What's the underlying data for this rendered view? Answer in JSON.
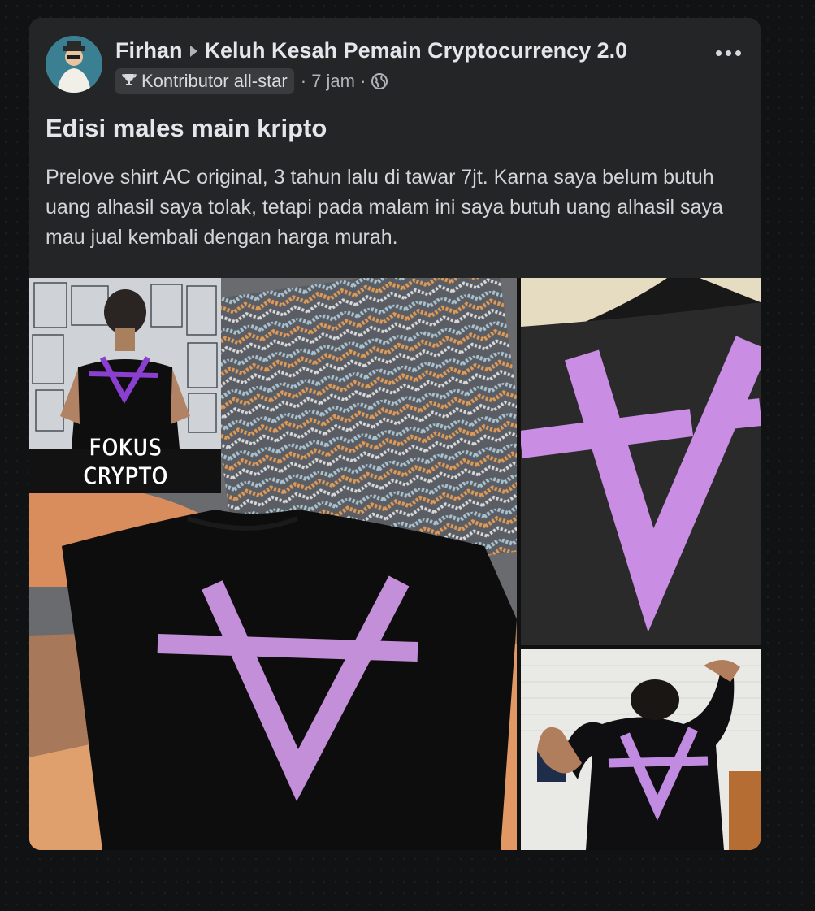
{
  "post": {
    "author": "Firhan",
    "group": "Keluh Kesah Pemain Cryptocurrency 2.0",
    "badge": "Kontributor all-star",
    "time": "· 7 jam ·",
    "title": "Edisi males main kripto",
    "body": "Prelove shirt AC original, 3 tahun lalu di tawar 7jt. Karna saya belum butuh uang alhasil saya tolak, tetapi pada malam ini saya butuh uang alhasil saya mau jual kembali dengan harga murah."
  },
  "photos": {
    "overlay_caption": "FOKUS CRYPTO",
    "photo_count": 4
  },
  "icons": {
    "badge": "trophy-icon",
    "privacy": "globe-icon",
    "separator": "caret-right-icon",
    "menu": "more-options-icon"
  },
  "colors": {
    "card": "#242526",
    "shirt": "#0d0d0d",
    "logo": "#c88fe0",
    "logo_bright": "#b76fe6"
  }
}
